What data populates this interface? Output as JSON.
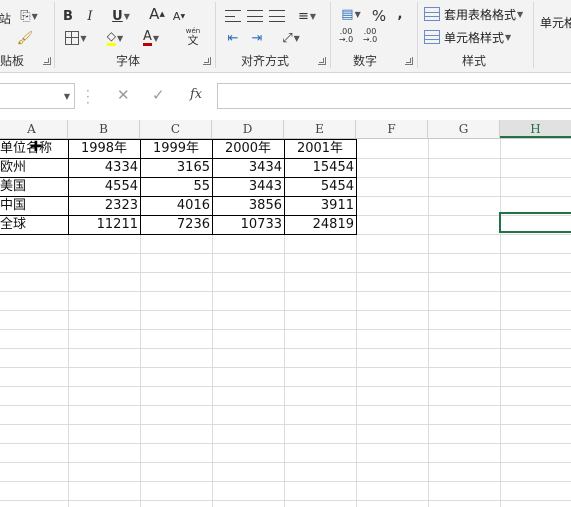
{
  "ribbon": {
    "clipboard": {
      "label": "贴板"
    },
    "font": {
      "label": "字体",
      "bold": "B",
      "italic": "I",
      "underline": "U",
      "grow": "A",
      "shrink": "A",
      "font_color": "A",
      "phonetic": "wén",
      "phonetic_char": "文"
    },
    "alignment": {
      "label": "对齐方式"
    },
    "number": {
      "label": "数字",
      "percent": "%",
      "comma": ",",
      "inc_decimal": ".00",
      "inc_decimal2": "→.0",
      "dec_decimal": ".00",
      "dec_decimal2": "→.0"
    },
    "styles": {
      "label": "样式",
      "format_table": "套用表格格式",
      "cell_styles": "单元格样式"
    },
    "cells": {
      "label": "单元格"
    }
  },
  "formula_bar": {
    "name_box": "",
    "cancel": "✕",
    "enter": "✓",
    "fx": "fx",
    "formula": ""
  },
  "columns": [
    "A",
    "B",
    "C",
    "D",
    "E",
    "F",
    "G",
    "H"
  ],
  "selected_column": "H",
  "sheet": {
    "header": [
      "单位名称",
      "1998年",
      "1999年",
      "2000年",
      "2001年"
    ],
    "rows": [
      [
        "欧州",
        "4334",
        "3165",
        "3434",
        "15454"
      ],
      [
        "美国",
        "4554",
        "55",
        "3443",
        "5454"
      ],
      [
        "中国",
        "2323",
        "4016",
        "3856",
        "3911"
      ],
      [
        "全球",
        "11211",
        "7236",
        "10733",
        "24819"
      ]
    ]
  },
  "active_cell": "H5",
  "colors": {
    "accent": "#217346",
    "font_color": "#c00000",
    "fill_color": "#ffff00"
  }
}
